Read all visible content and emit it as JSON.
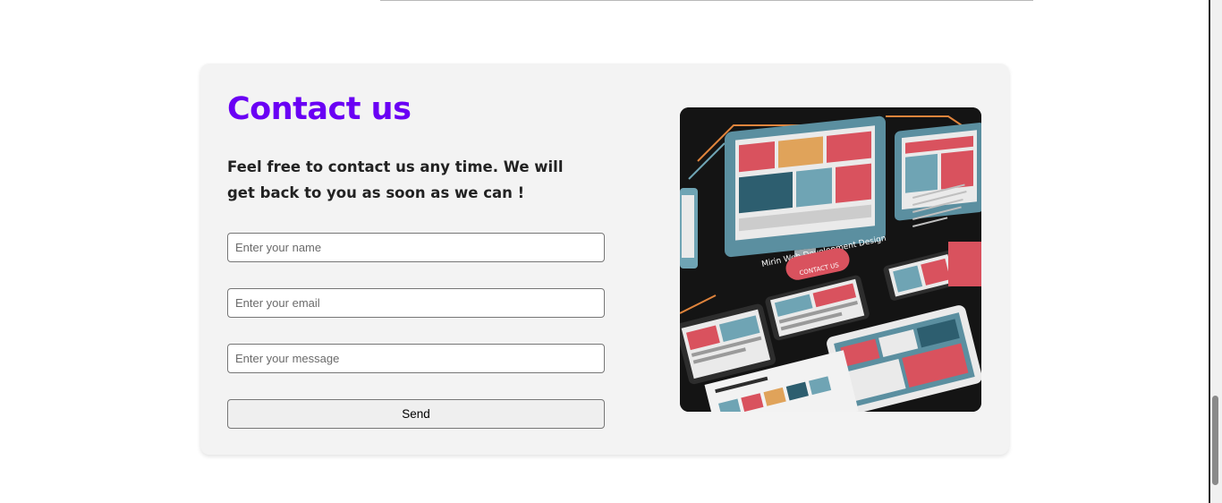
{
  "contact": {
    "title": "Contact us",
    "subtitle": "Feel free to contact us any time. We will get back to you as soon as we can !",
    "name_placeholder": "Enter your name",
    "email_placeholder": "Enter your email",
    "message_placeholder": "Enter your message",
    "send_label": "Send"
  },
  "illustration": {
    "icon": "web-design-illustration",
    "heading": "Mirin Web Development Design",
    "button_label": "CONTACT US"
  },
  "colors": {
    "accent": "#6a00f4",
    "card_background": "#f3f3f3",
    "illustration_background": "#141414",
    "illustration_teal": "#6fa4b4",
    "illustration_red": "#d9525e"
  }
}
